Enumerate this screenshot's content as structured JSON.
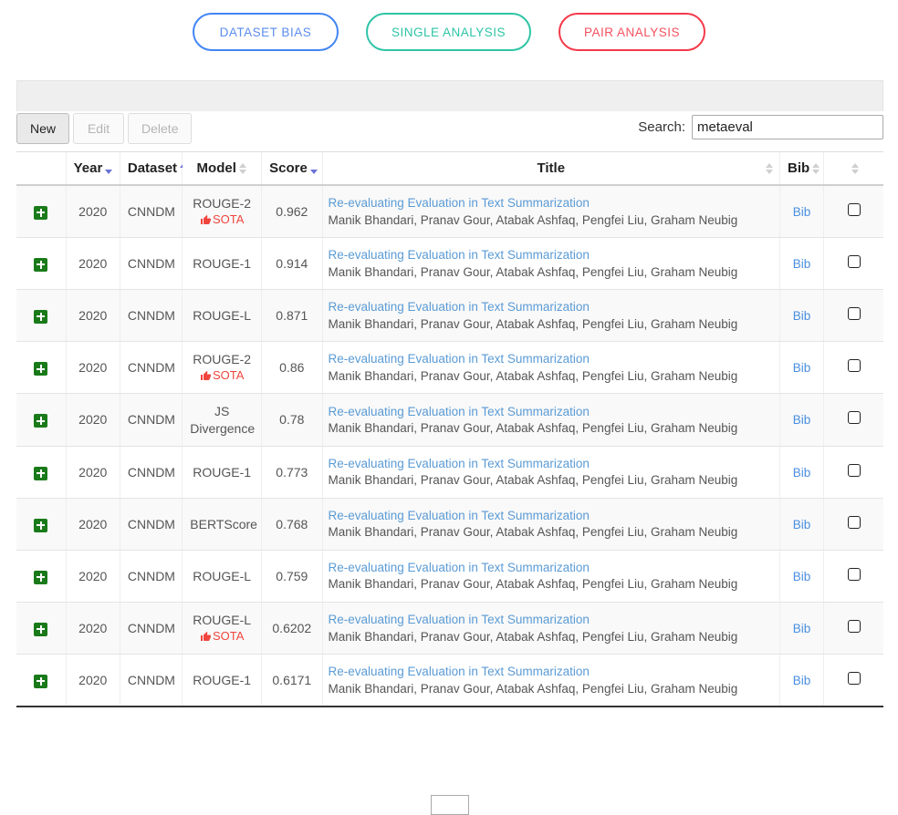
{
  "tabs": [
    {
      "label": "DATASET BIAS",
      "color": "#4285f4",
      "style": "blue"
    },
    {
      "label": "SINGLE ANALYSIS",
      "color": "#2ec4a6",
      "style": "green"
    },
    {
      "label": "PAIR ANALYSIS",
      "color": "#f4394a",
      "style": "red"
    }
  ],
  "toolbar": {
    "new_label": "New",
    "edit_label": "Edit",
    "delete_label": "Delete"
  },
  "search": {
    "label": "Search:",
    "value": "metaeval",
    "placeholder": ""
  },
  "table": {
    "columns": [
      {
        "label": "",
        "sort": "none"
      },
      {
        "label": "Year",
        "sort": "desc"
      },
      {
        "label": "Dataset",
        "sort": "asc"
      },
      {
        "label": "Model",
        "sort": "both"
      },
      {
        "label": "Score",
        "sort": "desc"
      },
      {
        "label": "Title",
        "sort": "both"
      },
      {
        "label": "Bib",
        "sort": "both"
      },
      {
        "label": "",
        "sort": "both"
      }
    ],
    "expand_icon": "plus-icon",
    "sota_icon": "thumbs-up-icon",
    "sota_label": "SOTA",
    "bib_label": "Bib",
    "rows": [
      {
        "year": "2020",
        "dataset": "CNNDM",
        "model": "ROUGE-2",
        "sota": true,
        "score": "0.962",
        "title": "Re-evaluating Evaluation in Text Summarization",
        "authors": "Manik Bhandari, Pranav Gour, Atabak Ashfaq, Pengfei Liu, Graham Neubig"
      },
      {
        "year": "2020",
        "dataset": "CNNDM",
        "model": "ROUGE-1",
        "sota": false,
        "score": "0.914",
        "title": "Re-evaluating Evaluation in Text Summarization",
        "authors": "Manik Bhandari, Pranav Gour, Atabak Ashfaq, Pengfei Liu, Graham Neubig"
      },
      {
        "year": "2020",
        "dataset": "CNNDM",
        "model": "ROUGE-L",
        "sota": false,
        "score": "0.871",
        "title": "Re-evaluating Evaluation in Text Summarization",
        "authors": "Manik Bhandari, Pranav Gour, Atabak Ashfaq, Pengfei Liu, Graham Neubig"
      },
      {
        "year": "2020",
        "dataset": "CNNDM",
        "model": "ROUGE-2",
        "sota": true,
        "score": "0.86",
        "title": "Re-evaluating Evaluation in Text Summarization",
        "authors": "Manik Bhandari, Pranav Gour, Atabak Ashfaq, Pengfei Liu, Graham Neubig"
      },
      {
        "year": "2020",
        "dataset": "CNNDM",
        "model": "JS Divergence",
        "sota": false,
        "score": "0.78",
        "title": "Re-evaluating Evaluation in Text Summarization",
        "authors": "Manik Bhandari, Pranav Gour, Atabak Ashfaq, Pengfei Liu, Graham Neubig"
      },
      {
        "year": "2020",
        "dataset": "CNNDM",
        "model": "ROUGE-1",
        "sota": false,
        "score": "0.773",
        "title": "Re-evaluating Evaluation in Text Summarization",
        "authors": "Manik Bhandari, Pranav Gour, Atabak Ashfaq, Pengfei Liu, Graham Neubig"
      },
      {
        "year": "2020",
        "dataset": "CNNDM",
        "model": "BERTScore",
        "sota": false,
        "score": "0.768",
        "title": "Re-evaluating Evaluation in Text Summarization",
        "authors": "Manik Bhandari, Pranav Gour, Atabak Ashfaq, Pengfei Liu, Graham Neubig"
      },
      {
        "year": "2020",
        "dataset": "CNNDM",
        "model": "ROUGE-L",
        "sota": false,
        "score": "0.759",
        "title": "Re-evaluating Evaluation in Text Summarization",
        "authors": "Manik Bhandari, Pranav Gour, Atabak Ashfaq, Pengfei Liu, Graham Neubig"
      },
      {
        "year": "2020",
        "dataset": "CNNDM",
        "model": "ROUGE-L",
        "sota": true,
        "score": "0.6202",
        "title": "Re-evaluating Evaluation in Text Summarization",
        "authors": "Manik Bhandari, Pranav Gour, Atabak Ashfaq, Pengfei Liu, Graham Neubig"
      },
      {
        "year": "2020",
        "dataset": "CNNDM",
        "model": "ROUGE-1",
        "sota": false,
        "score": "0.6171",
        "title": "Re-evaluating Evaluation in Text Summarization",
        "authors": "Manik Bhandari, Pranav Gour, Atabak Ashfaq, Pengfei Liu, Graham Neubig"
      }
    ]
  }
}
